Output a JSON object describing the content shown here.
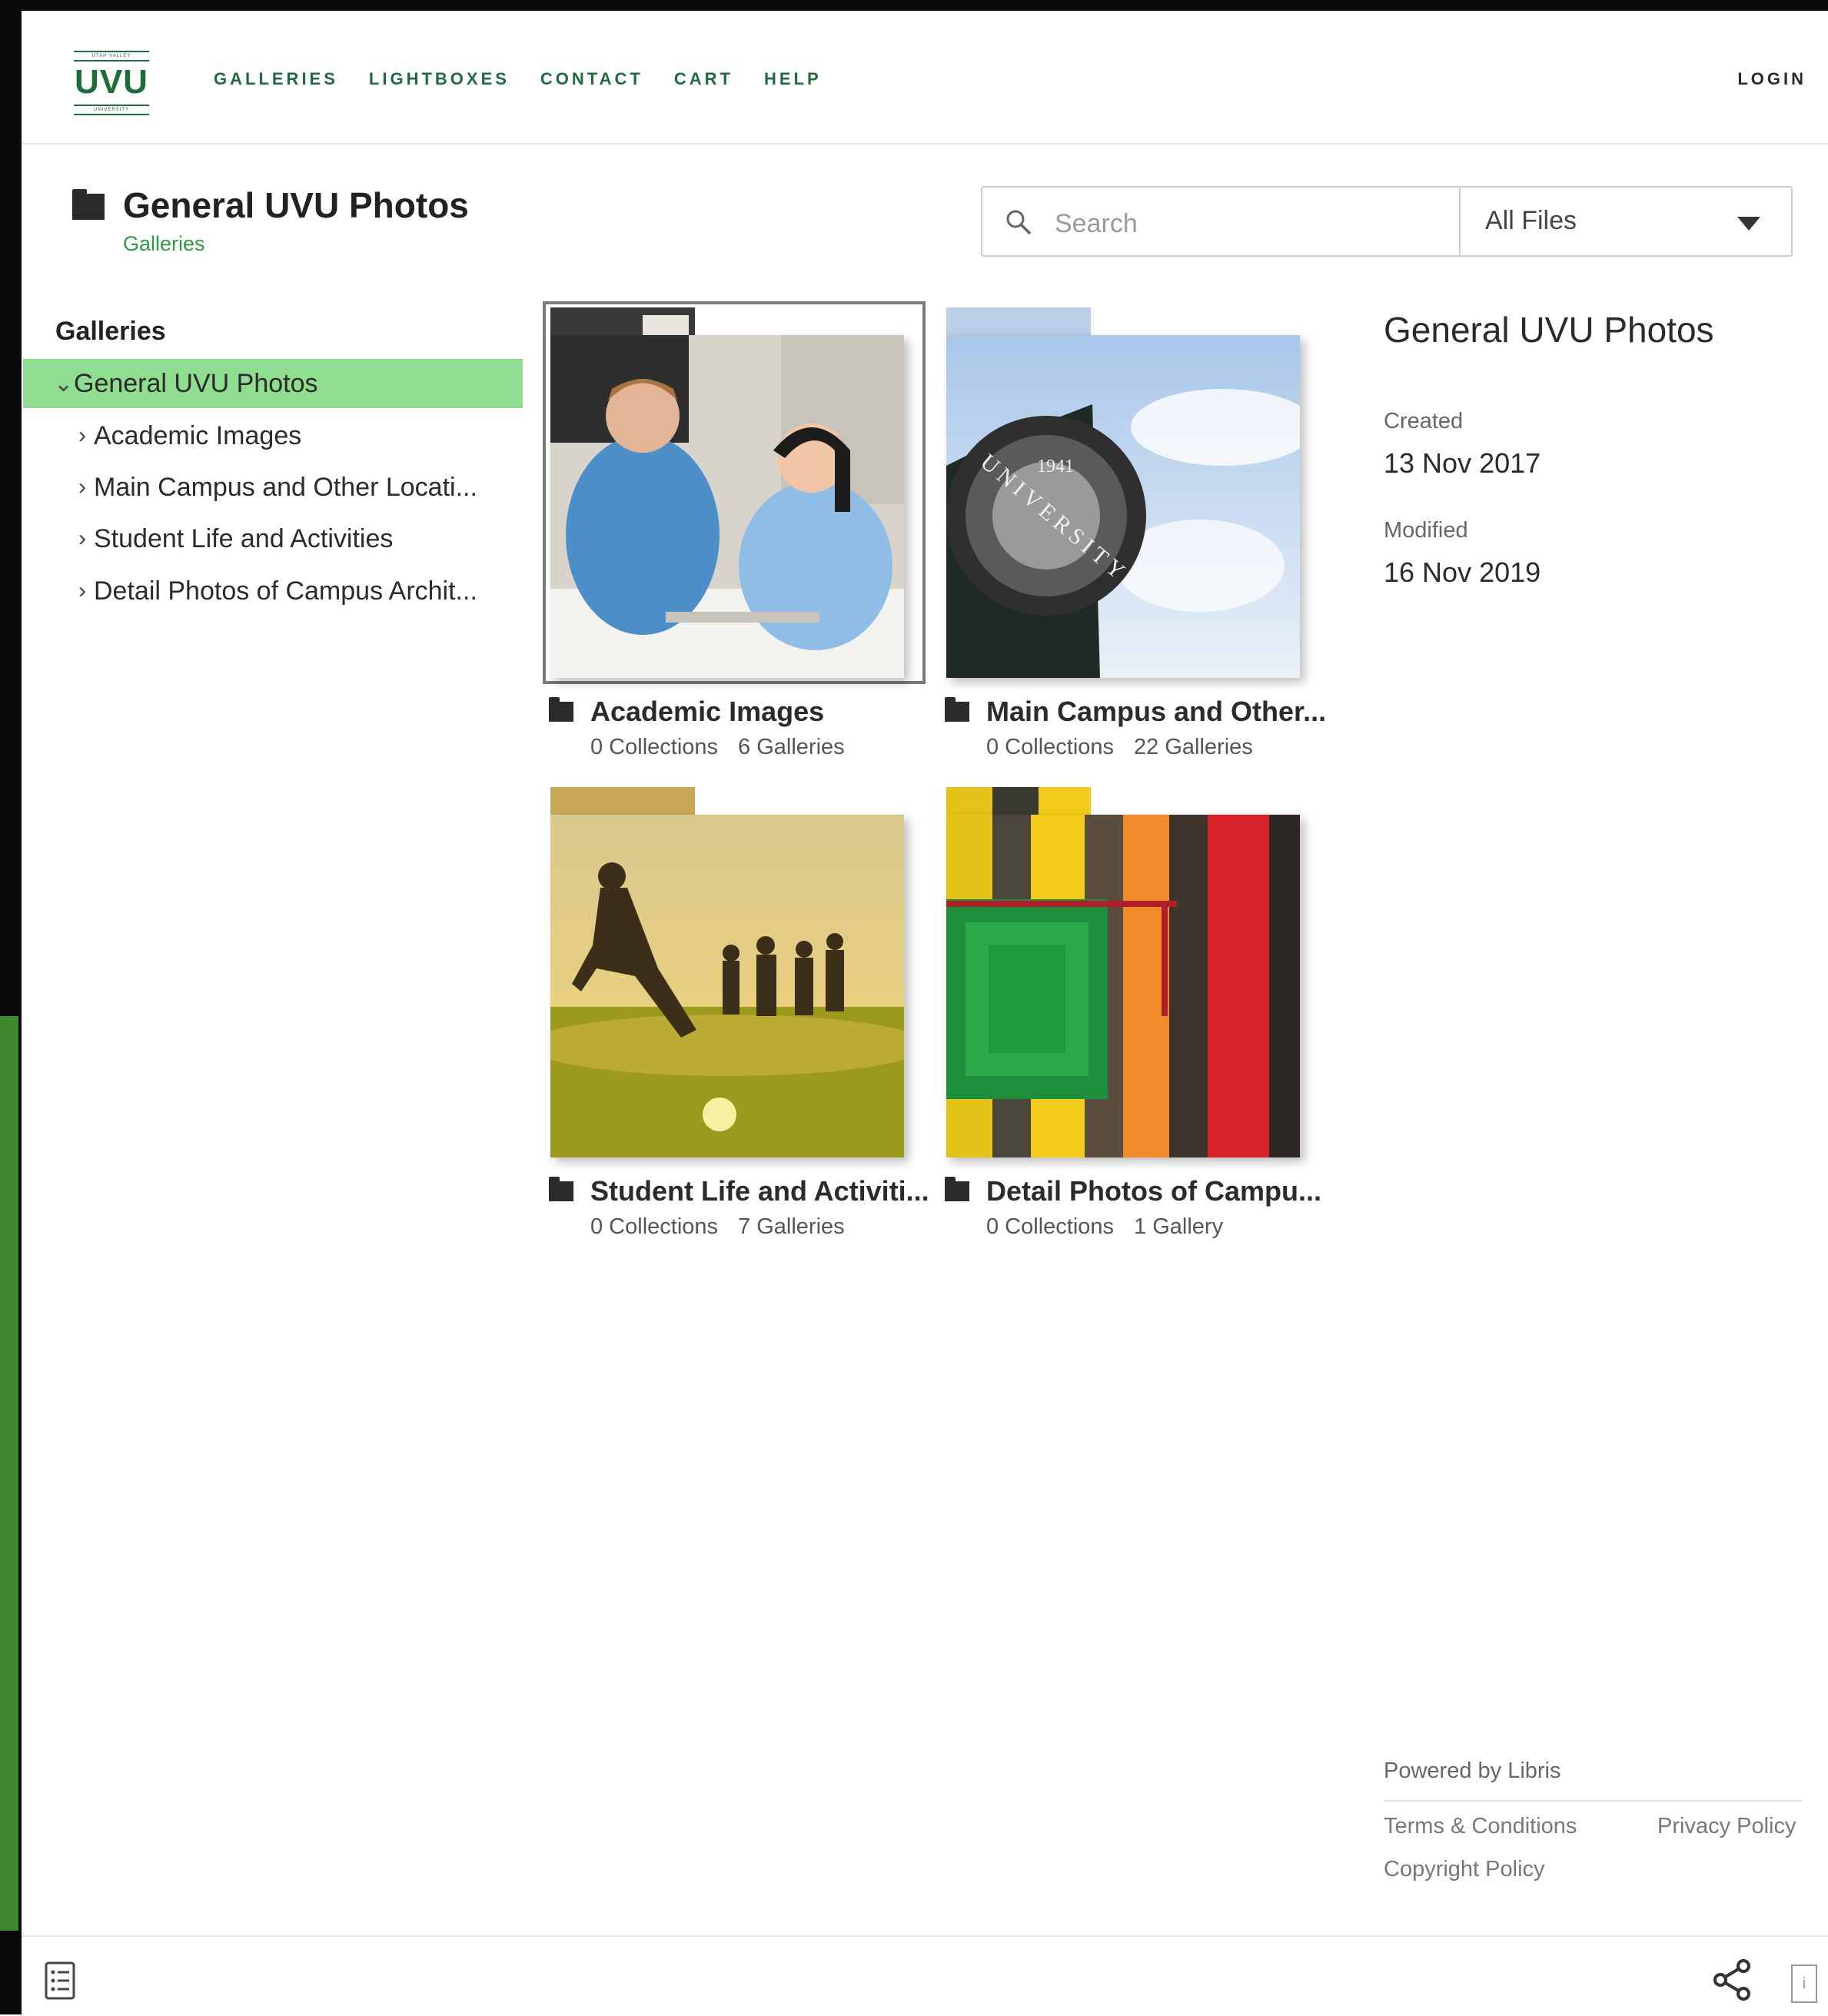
{
  "header": {
    "logo_top": "UTAH VALLEY",
    "logo_mid": "UVU",
    "logo_bot": "UNIVERSITY",
    "nav": [
      "GALLERIES",
      "LIGHTBOXES",
      "CONTACT",
      "CART",
      "HELP"
    ],
    "login": "LOGIN"
  },
  "page": {
    "title": "General UVU Photos",
    "breadcrumb": "Galleries"
  },
  "search": {
    "placeholder": "Search",
    "filter": "All Files"
  },
  "sidebar": {
    "heading": "Galleries",
    "active": "General UVU Photos",
    "items": [
      {
        "label": "Academic Images"
      },
      {
        "label": "Main Campus and Other Locati..."
      },
      {
        "label": "Student Life and Activities"
      },
      {
        "label": "Detail Photos of Campus Archit..."
      }
    ]
  },
  "cards": [
    {
      "title": "Academic Images",
      "collections": "0 Collections",
      "galleries": "6 Galleries"
    },
    {
      "title": "Main Campus and Other...",
      "collections": "0 Collections",
      "galleries": "22 Galleries"
    },
    {
      "title": "Student Life and Activiti...",
      "collections": "0 Collections",
      "galleries": "7 Galleries"
    },
    {
      "title": "Detail Photos of Campu...",
      "collections": "0 Collections",
      "galleries": "1 Gallery"
    }
  ],
  "details": {
    "title": "General UVU Photos",
    "created_label": "Created",
    "created": "13 Nov 2017",
    "modified_label": "Modified",
    "modified": "16 Nov 2019"
  },
  "seal": {
    "year": "1941",
    "word": "UNIVERSITY"
  },
  "footer": {
    "powered": "Powered by Libris",
    "terms": "Terms & Conditions",
    "privacy": "Privacy Policy",
    "copyright": "Copyright Policy"
  },
  "icons": [
    "folder-icon",
    "search-icon",
    "chevron-down-icon",
    "chevron-right-icon",
    "list-icon",
    "share-icon",
    "info-icon"
  ],
  "colors": {
    "brand_green": "#1f6b3a",
    "active_bg": "#8fdd8f",
    "link_green": "#2e9a45"
  }
}
